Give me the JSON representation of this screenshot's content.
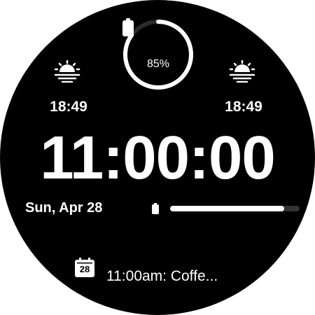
{
  "battery": {
    "percent_label": "85%",
    "level": 0.85
  },
  "sunrise": {
    "time": "18:49",
    "icon": "sunrise-icon"
  },
  "sunset": {
    "time": "18:49",
    "icon": "sunset-icon"
  },
  "clock": {
    "time": "11:00:00"
  },
  "date": {
    "label": "Sun, Apr 28"
  },
  "progress": {
    "level": 0.88
  },
  "calendar": {
    "day": "28",
    "event": "11:00am: Coffe..."
  },
  "colors": {
    "background": "#000000",
    "foreground": "#ffffff",
    "track": "#333333"
  }
}
